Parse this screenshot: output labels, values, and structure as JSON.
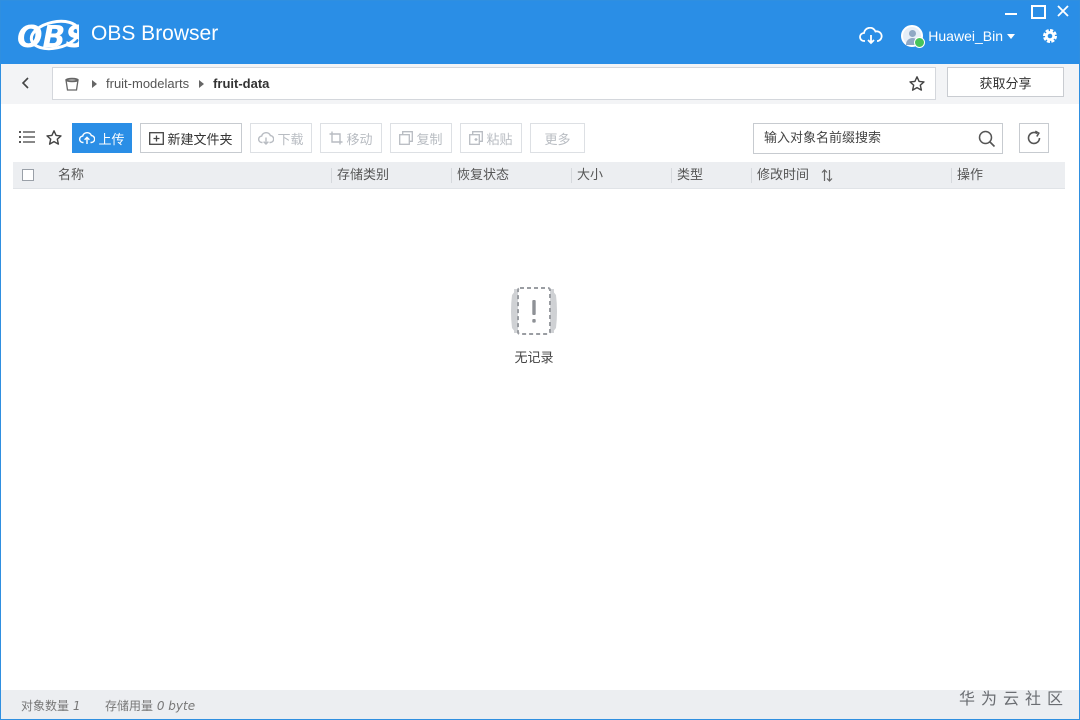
{
  "app": {
    "logo_text": "OBS",
    "title": "OBS Browser",
    "username": "Huawei_Bin"
  },
  "address": {
    "crumbs": [
      "fruit-modelarts",
      "fruit-data"
    ],
    "share_label": "获取分享"
  },
  "toolbar": {
    "upload_label": "上传",
    "new_folder_label": "新建文件夹",
    "download_label": "下载",
    "move_label": "移动",
    "copy_label": "复制",
    "paste_label": "粘贴",
    "more_label": "更多",
    "search_placeholder": "输入对象名前缀搜索"
  },
  "table": {
    "columns": [
      "名称",
      "存储类别",
      "恢复状态",
      "大小",
      "类型",
      "修改时间",
      "操作"
    ]
  },
  "empty_state": {
    "text": "无记录"
  },
  "status": {
    "object_count_label": "对象数量",
    "object_count_value": "1",
    "storage_label": "存储用量",
    "storage_value": "0 byte"
  },
  "watermark": "华为云社区",
  "colors": {
    "accent": "#2a8ee6",
    "online": "#46c35a"
  },
  "icons": [
    "cloud-sync-icon",
    "gear-icon",
    "back-arrow-icon",
    "bucket-icon",
    "star-icon",
    "list-view-icon",
    "upload-icon",
    "new-folder-icon",
    "download-icon",
    "move-icon",
    "copy-icon",
    "paste-icon",
    "search-icon",
    "refresh-icon",
    "sort-icon",
    "empty-record-icon"
  ]
}
